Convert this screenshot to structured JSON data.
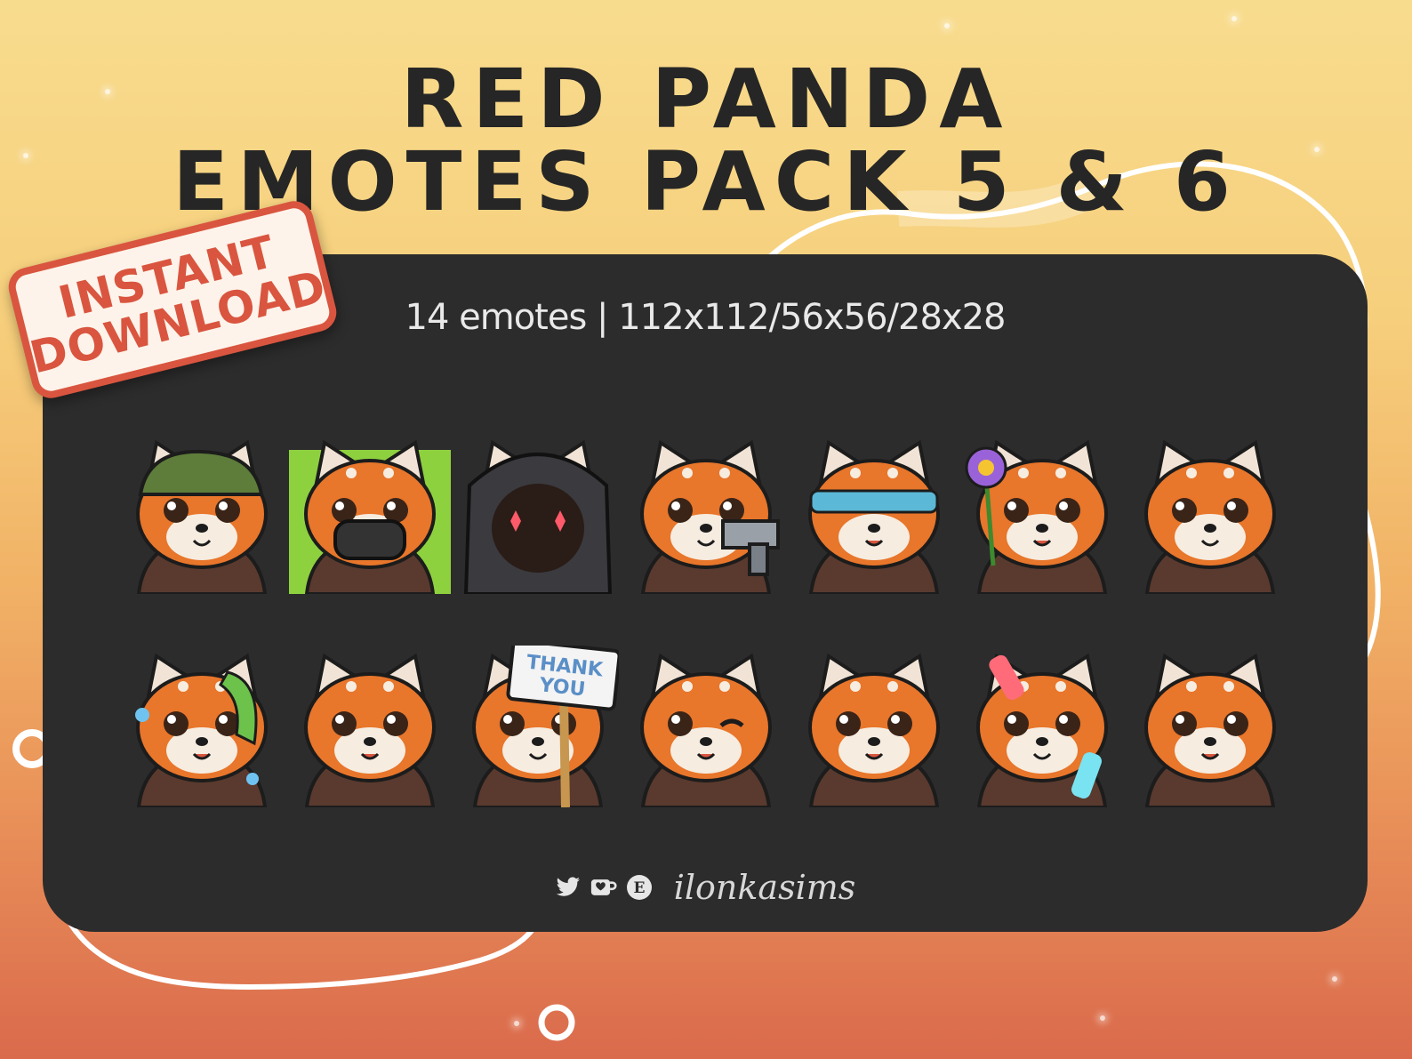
{
  "title": {
    "line1": "RED PANDA",
    "line2": "EMOTES PACK 5 & 6"
  },
  "badge": {
    "line1": "INSTANT",
    "line2": "DOWNLOAD"
  },
  "panel": {
    "subtitle": "14 emotes | 112x112/56x56/28x28"
  },
  "colors": {
    "panel": "#2c2c2c",
    "badge_red": "#d9553f",
    "fur_orange": "#e8762b",
    "fur_brown": "#5a3a2e"
  },
  "emotes": [
    {
      "name": "salute-helmet",
      "accessory": "helmet",
      "bg": ""
    },
    {
      "name": "gas-mask",
      "accessory": "mask",
      "bg": "#8ed13f"
    },
    {
      "name": "hooded-dark",
      "accessory": "hood",
      "bg": ""
    },
    {
      "name": "pistol",
      "accessory": "gun",
      "bg": ""
    },
    {
      "name": "blindfold-wave",
      "accessory": "blindfold",
      "bg": ""
    },
    {
      "name": "flower",
      "accessory": "flower",
      "bg": ""
    },
    {
      "name": "worried",
      "accessory": "none",
      "bg": ""
    },
    {
      "name": "sweat-towel",
      "accessory": "towel",
      "bg": ""
    },
    {
      "name": "shrug",
      "accessory": "none",
      "bg": ""
    },
    {
      "name": "thank-you-sign",
      "accessory": "sign",
      "bg": ""
    },
    {
      "name": "wink",
      "accessory": "none",
      "bg": ""
    },
    {
      "name": "point-up",
      "accessory": "none",
      "bg": ""
    },
    {
      "name": "glowsticks",
      "accessory": "glowstick",
      "bg": ""
    },
    {
      "name": "dab",
      "accessory": "none",
      "bg": ""
    }
  ],
  "sign_text": {
    "line1": "THANK",
    "line2": "YOU"
  },
  "footer": {
    "icons": [
      "twitter-icon",
      "kofi-icon",
      "etsy-icon"
    ],
    "etsy_letter": "E",
    "handle": "ilonkasims"
  }
}
